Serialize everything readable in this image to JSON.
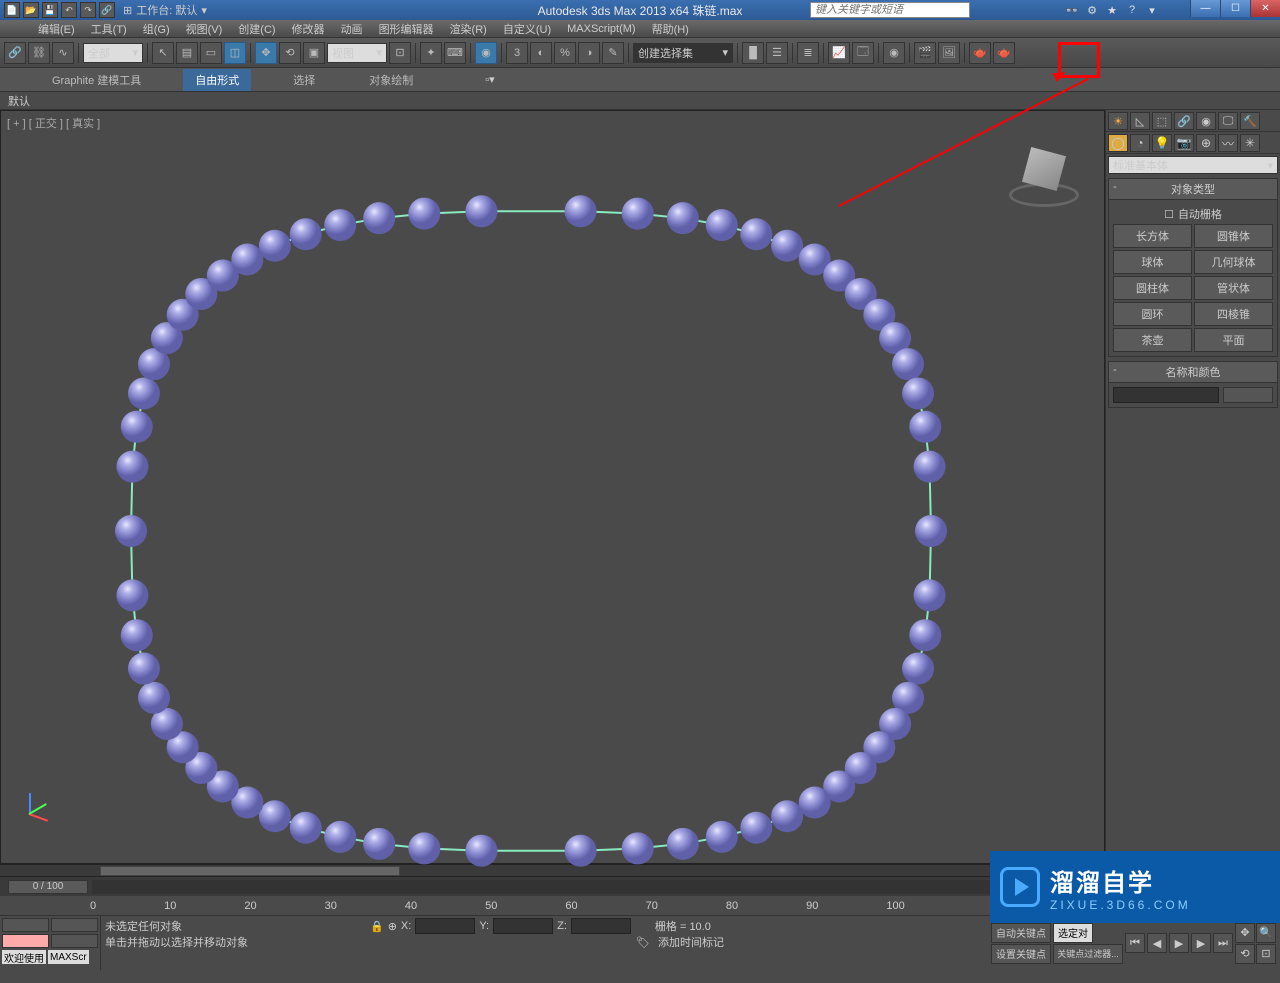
{
  "titlebar": {
    "workspace_label": "工作台: 默认",
    "app_title": "Autodesk 3ds Max  2013 x64     珠链.max",
    "search_placeholder": "键入关键字或短语"
  },
  "menu": {
    "items": [
      "编辑(E)",
      "工具(T)",
      "组(G)",
      "视图(V)",
      "创建(C)",
      "修改器",
      "动画",
      "图形编辑器",
      "渲染(R)",
      "自定义(U)",
      "MAXScript(M)",
      "帮助(H)"
    ]
  },
  "toolbar": {
    "filter_combo": "全部",
    "view_combo": "视图",
    "selset_combo": "创建选择集"
  },
  "ribbon": {
    "tabs": [
      "Graphite 建模工具",
      "自由形式",
      "选择",
      "对象绘制"
    ],
    "active": 1,
    "row2": "默认"
  },
  "viewport": {
    "label": "[ + ] [ 正交 ] [ 真实 ]"
  },
  "cmd_panel": {
    "category": "标准基本体",
    "rollout1_title": "对象类型",
    "autogrid": "自动栅格",
    "buttons": [
      "长方体",
      "圆锥体",
      "球体",
      "几何球体",
      "圆柱体",
      "管状体",
      "圆环",
      "四棱锥",
      "茶壶",
      "平面"
    ],
    "rollout2_title": "名称和颜色"
  },
  "timeline": {
    "pos": "0 / 100",
    "ticks": [
      "0",
      "10",
      "20",
      "30",
      "40",
      "50",
      "60",
      "70",
      "80",
      "90",
      "100"
    ]
  },
  "status": {
    "welcome": "欢迎使用",
    "maxscr": "MAXScr",
    "line1": "未选定任何对象",
    "line2": "单击并拖动以选择并移动对象",
    "x": "X:",
    "y": "Y:",
    "z": "Z:",
    "grid": "栅格 = 10.0",
    "addmarker": "添加时间标记",
    "autokey": "自动关键点",
    "selkey": "选定对",
    "setkey": "设置关键点",
    "keyfilter": "关键点过滤器..."
  },
  "watermark": {
    "t1": "溜溜自学",
    "t2": "ZIXUE.3D66.COM"
  }
}
